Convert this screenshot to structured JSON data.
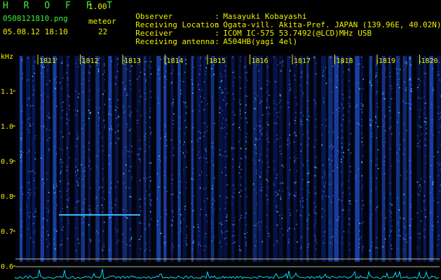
{
  "header": {
    "app_title": "H R O F F T",
    "app_version": "1.00",
    "file_name": "0508121810.png",
    "date_time": "05.08.12 18:10",
    "meteor_label": "meteor",
    "meteor_count": "22"
  },
  "info": [
    {
      "key": "Observer",
      "sep": ":",
      "value": "Masayuki Kobayashi"
    },
    {
      "key": "Receiving Location",
      "sep": ":",
      "value": "Ogata-vill. Akita-Pref. JAPAN (139.96E, 40.02N)"
    },
    {
      "key": "Receiver",
      "sep": ":",
      "value": "ICOM IC-575 53.7492(@LCD)MHz USB"
    },
    {
      "key": "Receiving antenna",
      "sep": ":",
      "value": "A504HB(yagi 4el)"
    }
  ],
  "chart_data": {
    "type": "heatmap",
    "ylabel": "kHz",
    "yticks": [
      "1.1",
      "1.0",
      "0.9",
      "0.8",
      "0.7",
      "0.6"
    ],
    "xticks": [
      "1811",
      "1812",
      "1813",
      "1814",
      "1815",
      "1816",
      "1817",
      "1818",
      "1819",
      "1820"
    ],
    "colors": {
      "background": "#000000",
      "low": "#0a1e6e",
      "mid": "#1e50d2",
      "high": "#3cf0f0",
      "label": "#f0f000",
      "trace": "#00d8e8"
    }
  }
}
